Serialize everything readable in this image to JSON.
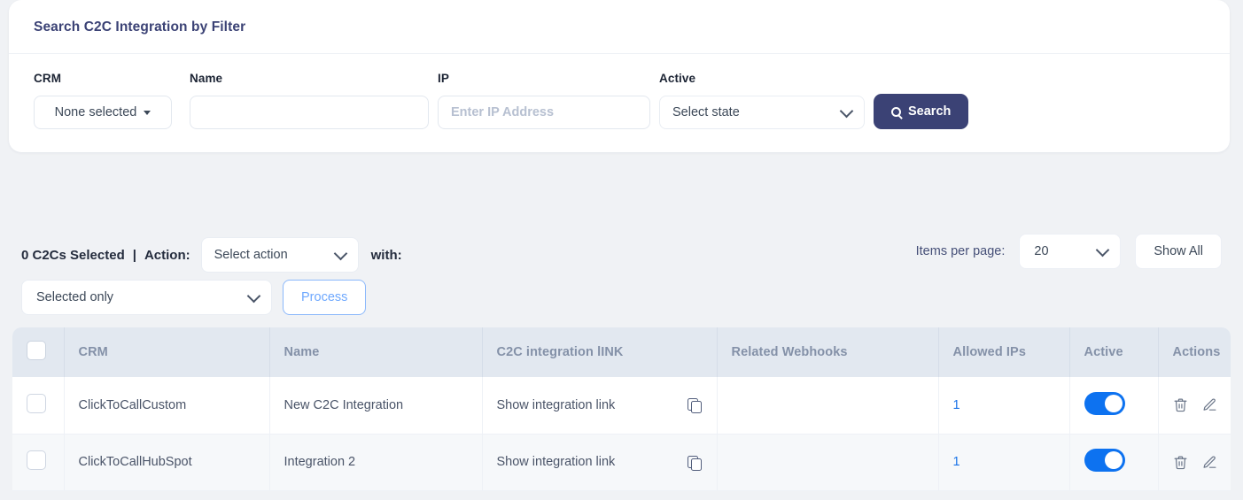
{
  "filter": {
    "title": "Search C2C Integration by Filter",
    "fields": {
      "crm": {
        "label": "CRM",
        "value": "None selected"
      },
      "name": {
        "label": "Name",
        "value": "",
        "placeholder": ""
      },
      "ip": {
        "label": "IP",
        "value": "",
        "placeholder": "Enter IP Address"
      },
      "active": {
        "label": "Active",
        "value": "Select state"
      }
    },
    "search_button": "Search",
    "search_icon": "search-icon",
    "search_button_color": "#3b4275"
  },
  "toolbar": {
    "selected_count_text": "0 C2Cs Selected",
    "separator": "|",
    "action_label": "Action:",
    "action_value": "Select action",
    "with_label": "with:",
    "scope_value": "Selected only",
    "process_label": "Process",
    "items_per_page_label": "Items per page:",
    "items_per_page_value": "20",
    "show_all_label": "Show All"
  },
  "table": {
    "columns": [
      "CRM",
      "Name",
      "C2C integration lINK",
      "Related Webhooks",
      "Allowed IPs",
      "Active",
      "Actions"
    ],
    "rows": [
      {
        "crm": "ClickToCallCustom",
        "name": "New C2C Integration",
        "link": "Show integration link",
        "webhooks": "",
        "allowed_ips": "1",
        "active": true
      },
      {
        "crm": "ClickToCallHubSpot",
        "name": "Integration 2",
        "link": "Show integration link",
        "webhooks": "",
        "allowed_ips": "1",
        "active": true
      }
    ],
    "toggle_on_color": "#0d72f0",
    "link_color": "#1a73e8"
  }
}
